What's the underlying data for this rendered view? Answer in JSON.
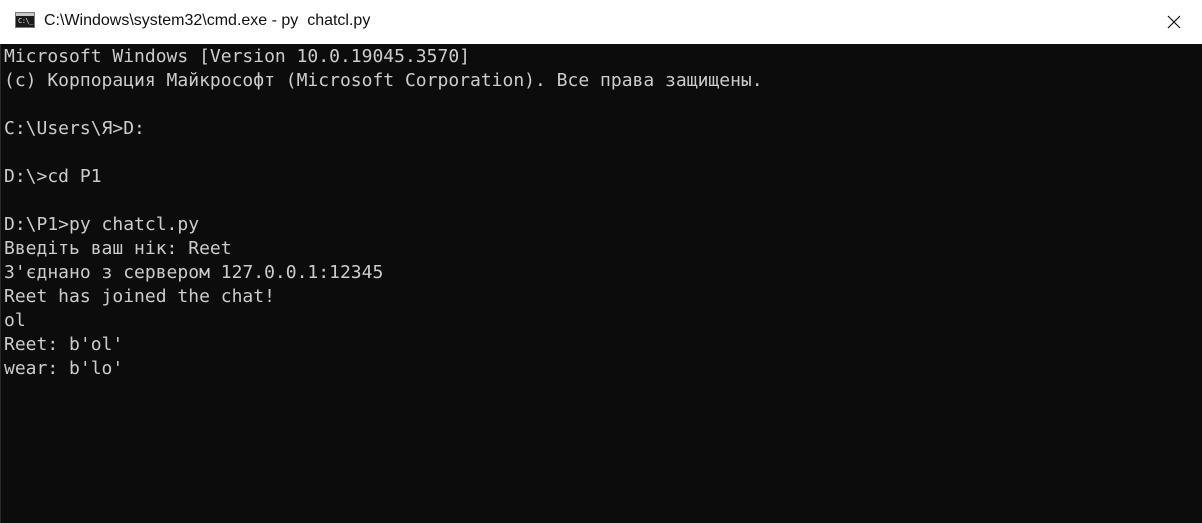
{
  "window": {
    "title": "C:\\Windows\\system32\\cmd.exe - py  chatcl.py",
    "icon_name": "cmd-app-icon",
    "icon_text": "C:\\_",
    "close_symbol": "✕"
  },
  "console": {
    "background": "#0c0c0c",
    "foreground": "#cccccc",
    "lines": [
      "Microsoft Windows [Version 10.0.19045.3570]",
      "(c) Корпорация Майкрософт (Microsoft Corporation). Все права защищены.",
      "",
      "C:\\Users\\Я>D:",
      "",
      "D:\\>cd P1",
      "",
      "D:\\P1>py chatcl.py",
      "Введіть ваш нік: Reet",
      "З'єднано з сервером 127.0.0.1:12345",
      "Reet has joined the chat!",
      "ol",
      "Reet: b'ol'",
      "wear: b'lo'"
    ]
  }
}
